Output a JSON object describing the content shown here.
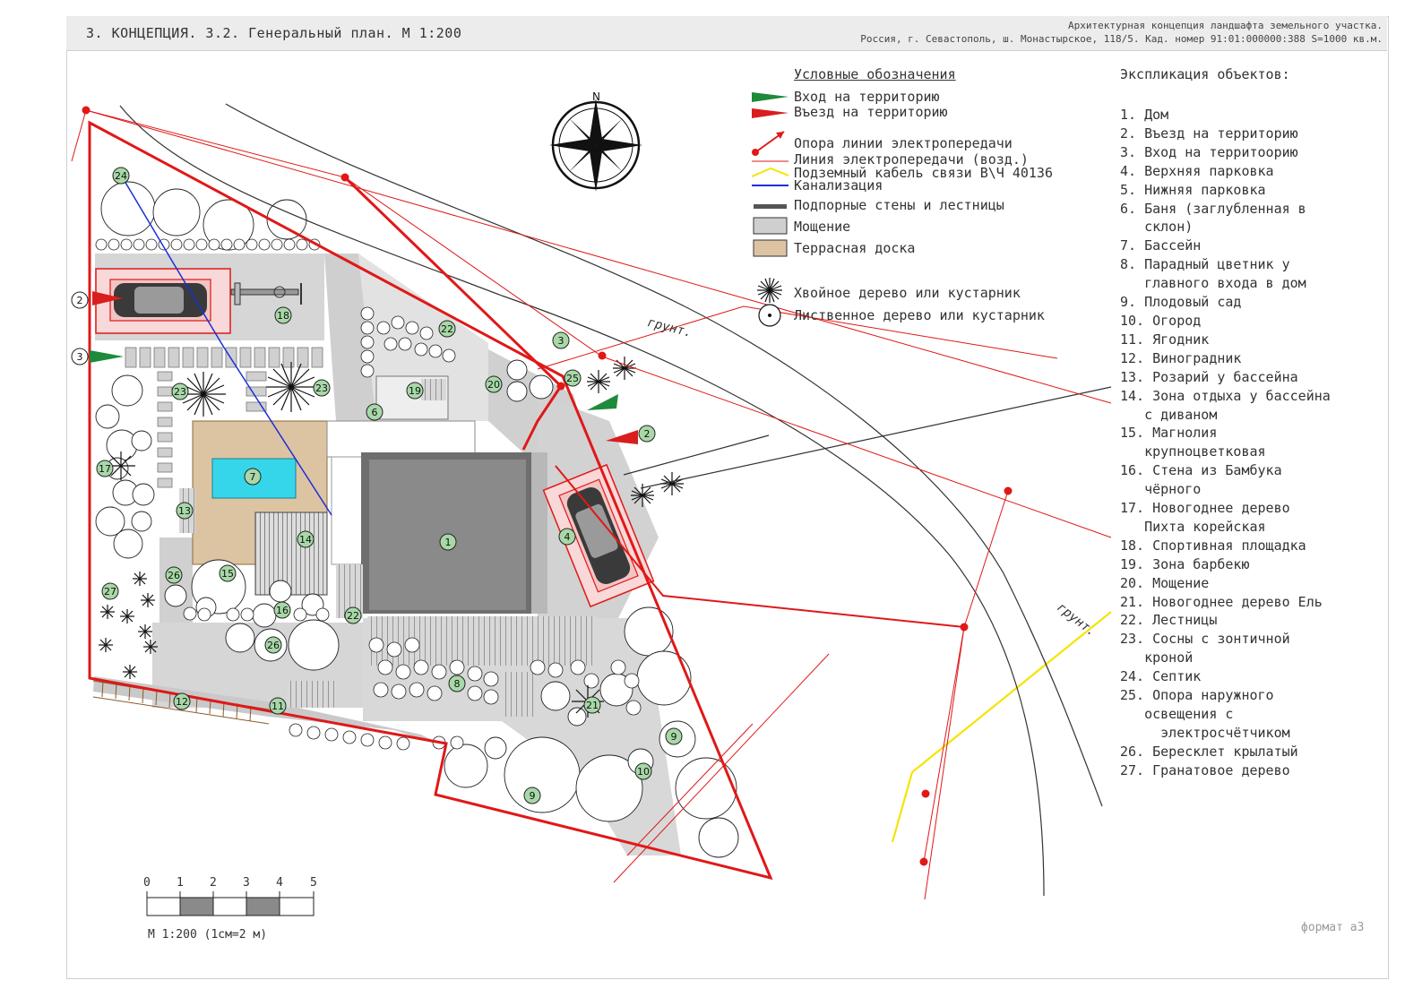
{
  "header": {
    "title": "3. КОНЦЕПЦИЯ. 3.2. Генеральный план. М 1:200",
    "subtitle_line1": "Архитектурная концепция ландшафта земельного участка.",
    "subtitle_line2": "Россия, г. Севастополь, ш. Монастырское, 118/5. Кад. номер 91:01:000000:388 S=1000 кв.м."
  },
  "legend": {
    "title": "Условные обозначения",
    "items": [
      {
        "label": "Вход на территорию",
        "icon": "green-flag-icon",
        "color": "#1e8a3a"
      },
      {
        "label": "Въезд на территорию",
        "icon": "red-flag-icon",
        "color": "#d81e1e"
      },
      {
        "label": "Опора линии электропередачи",
        "icon": "pole-arrow-icon",
        "color": "#e01818"
      },
      {
        "label": "Линия электропередачи (возд.)",
        "icon": "thin-red-line-icon",
        "color": "#e01818"
      },
      {
        "label": "Подземный кабель связи В\\Ч 40136",
        "icon": "yellow-line-icon",
        "color": "#f5e400"
      },
      {
        "label": "Канализация",
        "icon": "blue-line-icon",
        "color": "#1a2fd8"
      },
      {
        "label": "Подпорные стены и лестницы",
        "icon": "dark-bar-icon",
        "color": "#555555"
      },
      {
        "label": "Мощение",
        "icon": "grey-swatch-icon",
        "color": "#cfcfcf"
      },
      {
        "label": "Террасная доска",
        "icon": "tan-swatch-icon",
        "color": "#dcc4a3"
      },
      {
        "label": "Хвойное дерево или кустарник",
        "icon": "conifer-icon",
        "color": "#111111"
      },
      {
        "label": "Лиственное дерево или кустарник",
        "icon": "deciduous-icon",
        "color": "#111111"
      }
    ]
  },
  "explication": {
    "title": "Экспликация объектов:",
    "items": [
      "1. Дом",
      "2. Въезд на территорию",
      "3. Вход на территоорию",
      "4. Верхняя парковка",
      "5. Нижняя парковка",
      "6. Баня (заглубленная в\n   склон)",
      "7. Бассейн",
      "8. Парадный цветник у\n   главного входа в дом",
      "9. Плодовый сад",
      "10. Огород",
      "11. Ягодник",
      "12. Виноградник",
      "13. Розарий у бассейна",
      "14. Зона отдыха у бассейна\n   с диваном",
      "15. Магнолия\n   крупноцветковая",
      "16. Стена из Бамбука\n   чёрного",
      "17. Новогоднее дерево\n   Пихта корейская",
      "18. Спортивная площадка",
      "19. Зона барбекю",
      "20. Мощение",
      "21. Новогоднее дерево Ель",
      "22. Лестницы",
      "23. Сосны с зонтичной\n   кроной",
      "24. Септик",
      "25. Опора наружного\n   освещения с\n     электросчётчиком",
      "26. Бересклет крылатый",
      "27. Гранатовое дерево"
    ]
  },
  "plan": {
    "ground_label": "грунт.",
    "markers": [
      "1",
      "2",
      "3",
      "4",
      "6",
      "7",
      "8",
      "9",
      "9",
      "10",
      "11",
      "12",
      "13",
      "14",
      "15",
      "16",
      "17",
      "18",
      "19",
      "20",
      "21",
      "22",
      "22",
      "23",
      "23",
      "24",
      "25",
      "26",
      "26",
      "27"
    ],
    "colors": {
      "site_boundary": "#e01818",
      "marker_fill": "#a8d8a8",
      "pool": "#35d6ea",
      "terrace": "#dcc4a3",
      "house": "#8a8a8a"
    }
  },
  "scale": {
    "ticks": [
      "0",
      "1",
      "2",
      "3",
      "4",
      "5"
    ],
    "caption": "М 1:200 (1см=2 м)"
  },
  "footer": {
    "format": "формат а3"
  }
}
